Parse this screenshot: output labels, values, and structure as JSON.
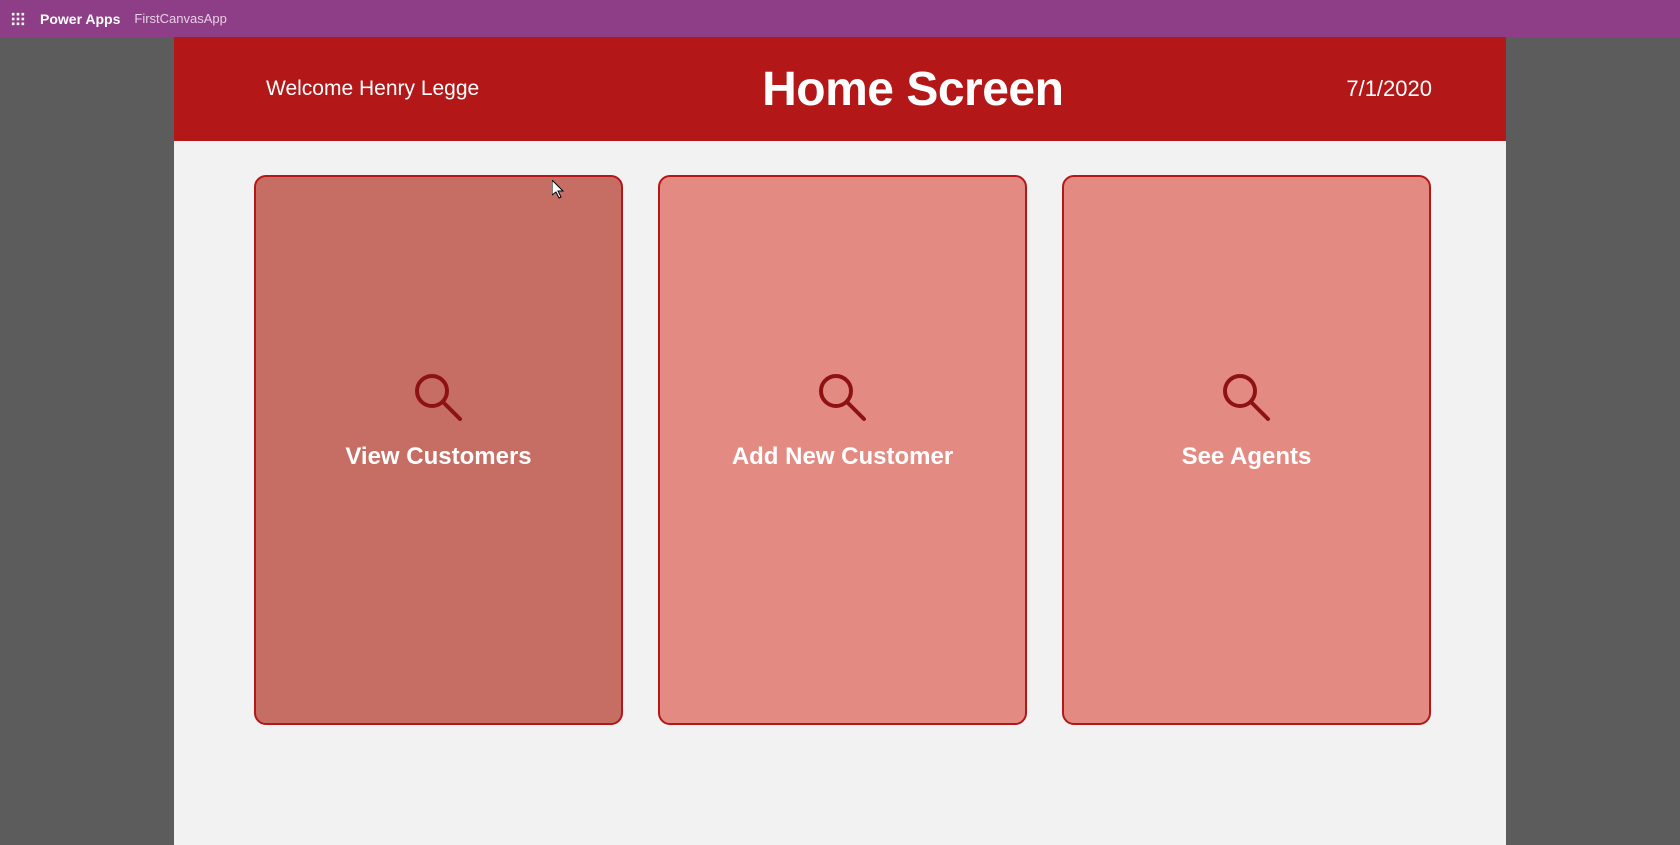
{
  "topbar": {
    "brand": "Power Apps",
    "app_name": "FirstCanvasApp"
  },
  "header": {
    "welcome": "Welcome Henry Legge",
    "title": "Home Screen",
    "date": "7/1/2020"
  },
  "tiles": [
    {
      "label": "View Customers"
    },
    {
      "label": "Add New Customer"
    },
    {
      "label": "See Agents"
    }
  ],
  "colors": {
    "topbar": "#8e3e87",
    "banner": "#b31717",
    "tile": "#e38b82",
    "tile_hover": "#c66d64",
    "canvas": "#f2f2f2"
  }
}
